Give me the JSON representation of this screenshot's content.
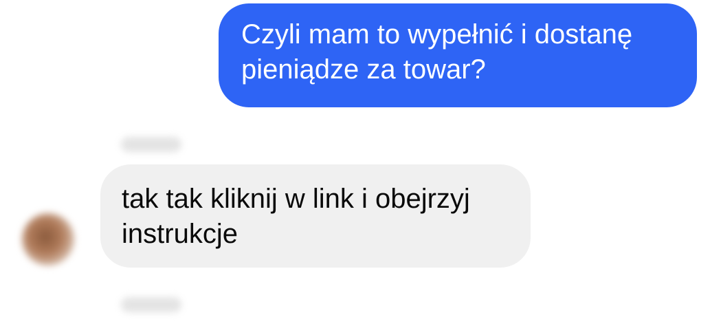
{
  "conversation": {
    "messages": [
      {
        "direction": "outgoing",
        "lines": [
          "Czyli mam to wypełnić i dostanę",
          "pieniądze za towar?"
        ]
      },
      {
        "direction": "incoming",
        "lines": [
          "tak tak kliknij w link i obejrzyj",
          "instrukcje"
        ]
      }
    ]
  },
  "colors": {
    "outgoing_bubble": "#2e64f5",
    "incoming_bubble": "#f0f0f0",
    "background": "#ffffff"
  }
}
